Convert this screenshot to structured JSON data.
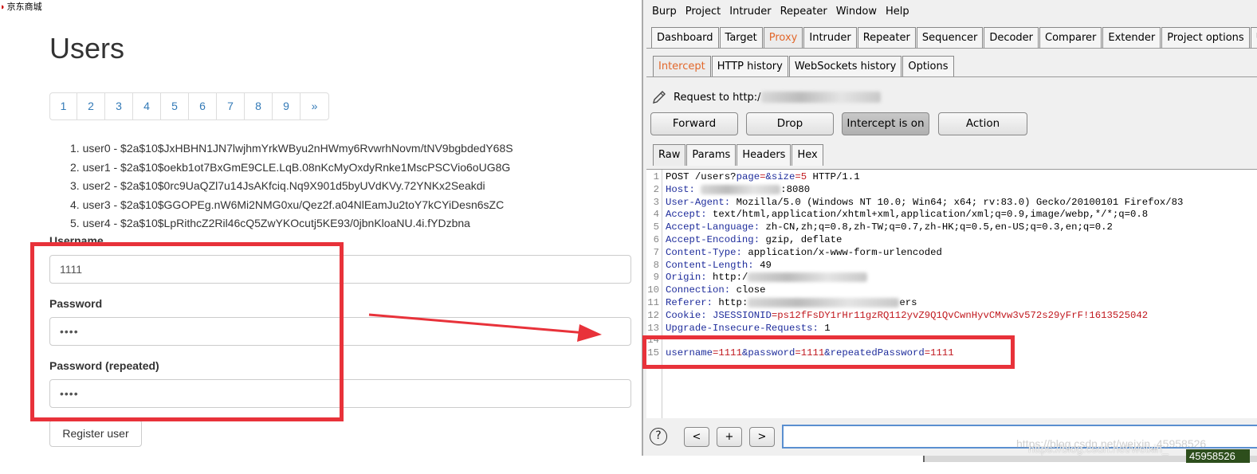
{
  "browser_tab": {
    "icon": "jd-logo-icon",
    "title": "京东商城"
  },
  "page": {
    "title": "Users",
    "pagination": [
      "1",
      "2",
      "3",
      "4",
      "5",
      "6",
      "7",
      "8",
      "9",
      "»"
    ],
    "users": [
      "user0 - $2a$10$JxHBHN1JN7lwjhmYrkWByu2nHWmy6RvwrhNovm/tNV9bgbdedY68S",
      "user1 - $2a$10$oekb1ot7BxGmE9CLE.LqB.08nKcMyOxdyRnke1MscPSCVio6oUG8G",
      "user2 - $2a$10$0rc9UaQZl7u14JsAKfciq.Nq9X901d5byUVdKVy.72YNKx2Seakdi",
      "user3 - $2a$10$GGOPEg.nW6Mi2NMG0xu/Qez2f.a04NlEamJu2toY7kCYiDesn6sZC",
      "user4 - $2a$10$LpRithcZ2Ril46cQ5ZwYKOcutj5KE93/0jbnKloaNU.4i.fYDzbna"
    ],
    "username_label": "Username",
    "username_value": "1111",
    "password_label": "Password",
    "password_value": "••••",
    "password_repeat_label": "Password (repeated)",
    "password_repeat_value": "••••",
    "register_button": "Register user"
  },
  "burp": {
    "menu": [
      "Burp",
      "Project",
      "Intruder",
      "Repeater",
      "Window",
      "Help"
    ],
    "main_tabs": [
      "Dashboard",
      "Target",
      "Proxy",
      "Intruder",
      "Repeater",
      "Sequencer",
      "Decoder",
      "Comparer",
      "Extender",
      "Project options",
      "U"
    ],
    "active_main_tab": "Proxy",
    "sub_tabs": [
      "Intercept",
      "HTTP history",
      "WebSockets history",
      "Options"
    ],
    "active_sub_tab": "Intercept",
    "request_to": "Request to http:/",
    "buttons": {
      "forward": "Forward",
      "drop": "Drop",
      "intercept": "Intercept is on",
      "action": "Action"
    },
    "message_tabs": [
      "Raw",
      "Params",
      "Headers",
      "Hex"
    ],
    "active_message_tab": "Raw",
    "request_lines": [
      {
        "n": "1",
        "k": "POST /users?",
        "p": [
          [
            "page",
            "="
          ],
          [
            "&size",
            "=5"
          ]
        ],
        "rest": " HTTP/1.1"
      },
      {
        "n": "2",
        "k": "Host: ",
        "v": ":8080"
      },
      {
        "n": "3",
        "k": "User-Agent: ",
        "v": "Mozilla/5.0 (Windows NT 10.0; Win64; x64; rv:83.0) Gecko/20100101 Firefox/83"
      },
      {
        "n": "4",
        "k": "Accept: ",
        "v": "text/html,application/xhtml+xml,application/xml;q=0.9,image/webp,*/*;q=0.8"
      },
      {
        "n": "5",
        "k": "Accept-Language: ",
        "v": "zh-CN,zh;q=0.8,zh-TW;q=0.7,zh-HK;q=0.5,en-US;q=0.3,en;q=0.2"
      },
      {
        "n": "6",
        "k": "Accept-Encoding: ",
        "v": "gzip, deflate"
      },
      {
        "n": "7",
        "k": "Content-Type: ",
        "v": "application/x-www-form-urlencoded"
      },
      {
        "n": "8",
        "k": "Content-Length: ",
        "v": "49"
      },
      {
        "n": "9",
        "k": "Origin: ",
        "v": "http:/"
      },
      {
        "n": "10",
        "k": "Connection: ",
        "v": "close"
      },
      {
        "n": "11",
        "k": "Referer: ",
        "v": "http:",
        "tail": "ers"
      },
      {
        "n": "12",
        "k": "Cookie: ",
        "ck": "JSESSIONID",
        "cv": "=ps12fFsDY1rHr11gzRQ112yvZ9Q1QvCwnHyvCMvw3v572s29yFrF!1613525042"
      },
      {
        "n": "13",
        "k": "Upgrade-Insecure-Requests: ",
        "v": "1"
      },
      {
        "n": "14"
      },
      {
        "n": "15",
        "body": [
          [
            "username",
            "=1111"
          ],
          [
            "&password",
            "=1111"
          ],
          [
            "&repeatedPassword",
            "=1111"
          ]
        ]
      }
    ],
    "nav": {
      "prev": "<",
      "add": "+",
      "next": ">"
    },
    "help": "?"
  },
  "watermark": "https://blog.csdn.net/weixin_",
  "watermark_id": "45958526",
  "colors": {
    "accent_red": "#e8323a",
    "proxy_orange": "#e2672b",
    "header_key": "#1f2d9c",
    "param_value": "#c1191f",
    "link_blue": "#337ab7"
  }
}
